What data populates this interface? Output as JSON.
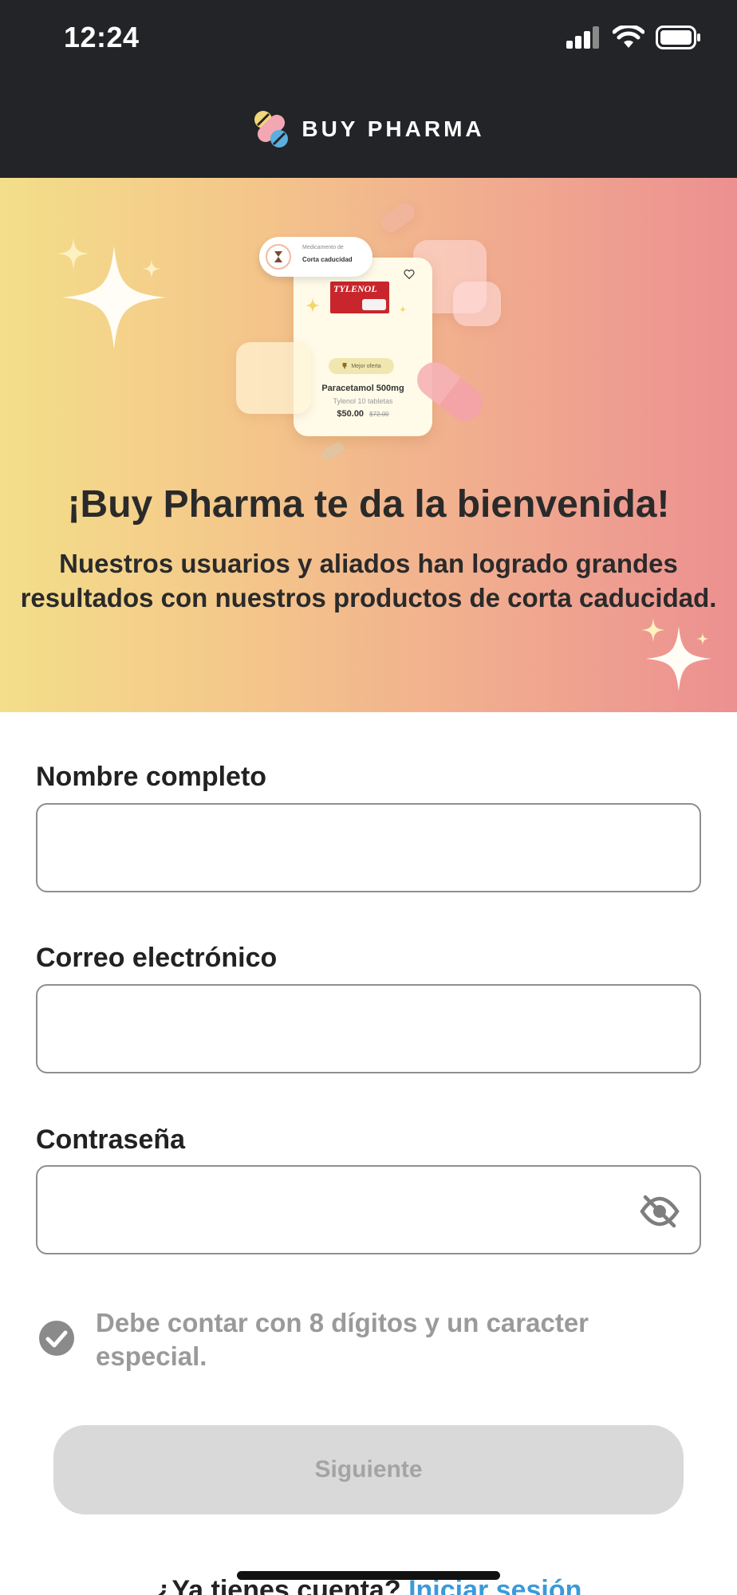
{
  "status_bar": {
    "time": "12:24"
  },
  "header": {
    "brand": "BUY PHARMA"
  },
  "hero": {
    "title": "¡Buy Pharma te da la bienvenida!",
    "subtitle": "Nuestros usuarios y aliados han logrado grandes resultados con nuestros productos de corta caducidad.",
    "illustration": {
      "chip_small": "Medicamento de",
      "chip_main": "Corta caducidad",
      "product_brand": "TYLENOL",
      "badge": "Mejor oferta",
      "product_name": "Paracetamol 500mg",
      "product_desc": "Tylenol 10 tabletas",
      "price": "$50.00",
      "old_price": "$72.00"
    }
  },
  "form": {
    "name_label": "Nombre completo",
    "email_label": "Correo electrónico",
    "password_label": "Contraseña",
    "name_value": "",
    "email_value": "",
    "password_value": "",
    "password_hint": "Debe contar con 8 dígitos y un caracter especial.",
    "submit_label": "Siguiente"
  },
  "footer": {
    "prompt": "¿Ya tienes cuenta?",
    "login_link": "Iniciar sesión"
  },
  "colors": {
    "header_bg": "#222427",
    "link": "#3a9ad9",
    "button_disabled_bg": "#d9d9d9",
    "button_disabled_text": "#a4a4a4"
  }
}
